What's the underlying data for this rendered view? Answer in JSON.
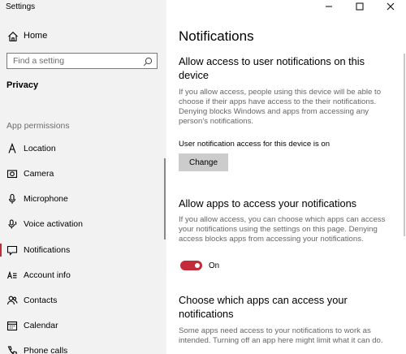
{
  "window": {
    "title": "Settings"
  },
  "sidebar": {
    "home_label": "Home",
    "search_placeholder": "Find a setting",
    "section_title": "Privacy",
    "group_label": "App permissions",
    "items": [
      {
        "label": "Location",
        "icon": "location-icon"
      },
      {
        "label": "Camera",
        "icon": "camera-icon"
      },
      {
        "label": "Microphone",
        "icon": "microphone-icon"
      },
      {
        "label": "Voice activation",
        "icon": "voice-activation-icon"
      },
      {
        "label": "Notifications",
        "icon": "notifications-icon",
        "active": true
      },
      {
        "label": "Account info",
        "icon": "account-info-icon"
      },
      {
        "label": "Contacts",
        "icon": "contacts-icon"
      },
      {
        "label": "Calendar",
        "icon": "calendar-icon"
      },
      {
        "label": "Phone calls",
        "icon": "phone-calls-icon"
      }
    ]
  },
  "main": {
    "page_title": "Notifications",
    "section1": {
      "heading": "Allow access to user notifications on this device",
      "description": "If you allow access, people using this device will be able to choose if their apps have access to the their notifications. Denying blocks Windows and apps from accessing any person’s notifications.",
      "status": "User notification access for this device is on",
      "button_label": "Change"
    },
    "section2": {
      "heading": "Allow apps to access your notifications",
      "description": "If you allow access, you can choose which apps can access your notifications using the settings on this page. Denying access blocks apps from accessing your notifications.",
      "toggle_label": "On",
      "toggle_on": true
    },
    "section3": {
      "heading": "Choose which apps can access your notifications",
      "description": "Some apps need access to your notifications to work as intended. Turning off an app here might limit what it can do."
    }
  },
  "colors": {
    "accent": "#c42b3a",
    "sidebar_bg": "#f2f2f2",
    "button_bg": "#cccccc",
    "secondary_text": "#666666"
  }
}
